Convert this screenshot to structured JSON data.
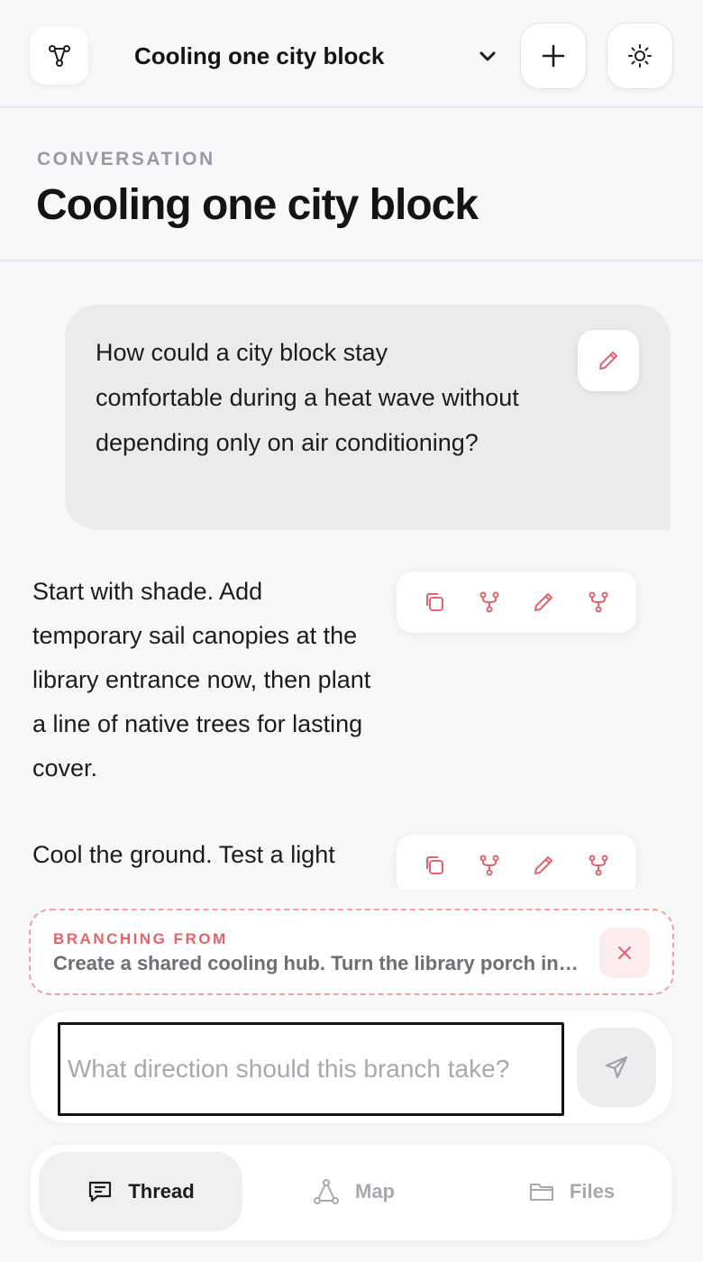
{
  "header": {
    "selected_conversation": "Cooling one city block"
  },
  "conversation": {
    "eyebrow": "CONVERSATION",
    "title": "Cooling one city block"
  },
  "messages": {
    "user": "How could a city block stay comfortable during a heat wave without depending only on air conditioning?",
    "assistant": [
      "Start with shade. Add temporary sail canopies at the library entrance now, then plant a line of native trees for lasting cover.",
      "Cool the ground. Test a light"
    ]
  },
  "branch": {
    "label": "BRANCHING FROM",
    "snippet": "Create a shared cooling hub. Turn the library porch into a daytime cooling hub with misters, seating, and water refill stations."
  },
  "composer": {
    "placeholder": "What direction should this branch take?",
    "value": ""
  },
  "nav": {
    "thread": "Thread",
    "map": "Map",
    "files": "Files"
  },
  "colors": {
    "accent": "#e0646e",
    "background": "#f8f8fa"
  },
  "icons": [
    "graph-logo-icon",
    "chevron-down-icon",
    "plus-icon",
    "sun-icon",
    "pencil-icon",
    "copy-icon",
    "branch-icon",
    "close-icon",
    "send-icon",
    "chat-icon",
    "map-icon",
    "folder-icon"
  ]
}
